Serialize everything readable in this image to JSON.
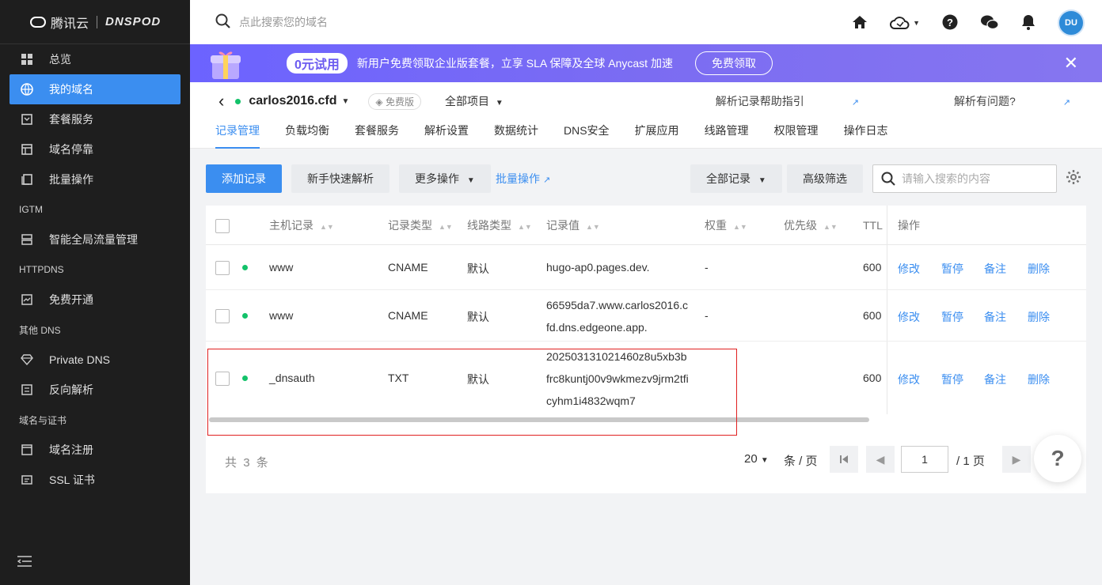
{
  "brand": {
    "tencent": "腾讯云",
    "dnspod": "DNSPOD"
  },
  "sidebar": {
    "items": [
      {
        "label": "总览",
        "icon": "grid-icon"
      },
      {
        "label": "我的域名",
        "icon": "globe-icon",
        "active": true
      },
      {
        "label": "套餐服务",
        "icon": "package-icon"
      },
      {
        "label": "域名停靠",
        "icon": "layout-icon"
      },
      {
        "label": "批量操作",
        "icon": "copy-icon"
      }
    ],
    "group_igtm": "IGTM",
    "igtm_items": [
      {
        "label": "智能全局流量管理",
        "icon": "server-icon"
      }
    ],
    "group_httpdns": "HTTPDNS",
    "httpdns_items": [
      {
        "label": "免费开通",
        "icon": "chart-icon"
      }
    ],
    "group_other": "其他 DNS",
    "other_items": [
      {
        "label": "Private DNS",
        "icon": "diamond-icon"
      },
      {
        "label": "反向解析",
        "icon": "reverse-icon"
      }
    ],
    "group_cert": "域名与证书",
    "cert_items": [
      {
        "label": "域名注册",
        "icon": "browser-icon"
      },
      {
        "label": "SSL 证书",
        "icon": "certificate-icon"
      }
    ]
  },
  "topbar": {
    "search_placeholder": "点此搜索您的域名"
  },
  "banner": {
    "badge": "0元试用",
    "message": "新用户免费领取企业版套餐，立享 SLA 保障及全球 Anycast 加速",
    "cta": "免费领取",
    "accent": "#6c63ff"
  },
  "domain": {
    "name": "carlos2016.cfd",
    "plan": "免费版",
    "project": "全部项目",
    "help_guide": "解析记录帮助指引",
    "problem": "解析有问题?"
  },
  "tabs": [
    "记录管理",
    "负载均衡",
    "套餐服务",
    "解析设置",
    "数据统计",
    "DNS安全",
    "扩展应用",
    "线路管理",
    "权限管理",
    "操作日志"
  ],
  "toolbar": {
    "add": "添加记录",
    "quick": "新手快速解析",
    "more": "更多操作",
    "batch": "批量操作",
    "all_records": "全部记录",
    "advanced": "高级筛选",
    "search_placeholder": "请输入搜索的内容"
  },
  "table": {
    "headers": {
      "host": "主机记录",
      "type": "记录类型",
      "line": "线路类型",
      "value": "记录值",
      "weight": "权重",
      "priority": "优先级",
      "ttl": "TTL",
      "ops": "操作"
    },
    "rows": [
      {
        "host": "www",
        "type": "CNAME",
        "line": "默认",
        "value": "hugo-ap0.pages.dev.",
        "weight": "-",
        "ttl": "600"
      },
      {
        "host": "www",
        "type": "CNAME",
        "line": "默认",
        "value": "66595da7.www.carlos2016.cfd.dns.edgeone.app.",
        "weight": "-",
        "ttl": "600"
      },
      {
        "host": "_dnsauth",
        "type": "TXT",
        "line": "默认",
        "value": "202503131021460z8u5xb3bfrc8kuntj00v9wkmezv9jrm2tficyhm1i4832wqm7",
        "weight": "",
        "ttl": "600"
      }
    ],
    "ops": {
      "edit": "修改",
      "pause": "暂停",
      "note": "备注",
      "delete": "删除"
    }
  },
  "pagination": {
    "total_prefix": "共",
    "total": "3",
    "total_suffix": "条",
    "page_size": "20",
    "per_page": "条 / 页",
    "current": "1",
    "pages": "/ 1 页"
  },
  "help_fab": "?"
}
